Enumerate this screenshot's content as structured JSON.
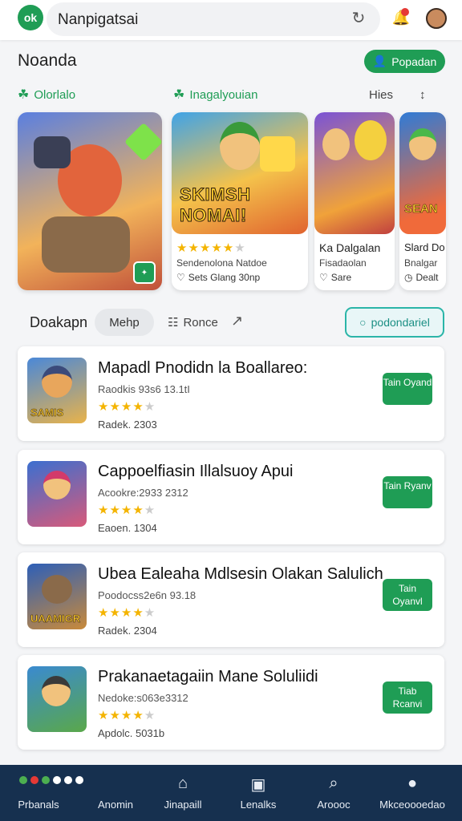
{
  "header": {
    "logo_text": "ok",
    "search_text": "Nanpigatsai",
    "refresh_icon": "refresh-icon",
    "bell_icon": "bell-icon"
  },
  "featured": {
    "title": "Noanda",
    "popular_button": "Popadan",
    "filters": [
      "Olorlalo",
      "Inagalyouian"
    ],
    "right_controls": [
      "Hies",
      "↕"
    ],
    "cards": [
      {
        "art_title": ""
      },
      {
        "art_title": "SKIMSH NOMAI!",
        "sub": "Sendenolona Natdoe",
        "meta": "Sets Glang 30np",
        "rating": 4
      },
      {
        "name": "Ka Dalgalan",
        "sub": "Fisadaolan",
        "meta": "Sare",
        "rating": 0
      },
      {
        "name": "Slard Do",
        "sub": "Bnalgar",
        "meta": "Dealt",
        "art_title": "SEAN",
        "rating": 0
      }
    ]
  },
  "tabs": {
    "main": "Doakapn",
    "pill": "Mehp",
    "icon_label": "Ronce",
    "download_button": "podondariel"
  },
  "list": [
    {
      "thumb_label": "SAMIS",
      "title": "Mapadl Pnodidn la Boallareo:",
      "sub": "Raodkis 93s6 13.1tI",
      "rating": 4,
      "meta": "Radek.  2303",
      "button": "Tain Oyand"
    },
    {
      "thumb_label": "",
      "title": "Cappoelfiasin Illalsuoy Apui",
      "sub": "Acookre:2933 2312",
      "rating": 4,
      "meta": "Eaoen.  1304",
      "button": "Tain Ryanv"
    },
    {
      "thumb_label": "UAAMIGR",
      "title": "Ubea Ealeaha Mdlsesin Olakan Salulich",
      "sub": "Poodocss2e6n 93.18",
      "rating": 4,
      "meta": "Radek.  2304",
      "button": "Tain Oyanvl"
    },
    {
      "thumb_label": "",
      "title": "Prakanaetagaiin Mane Soluliidi",
      "sub": "Nedoke:s063e3312",
      "rating": 4,
      "meta": "Apdolc.  5031b",
      "button": "Tiab Rcanvi"
    }
  ],
  "bottom_nav": [
    {
      "label": "Prbanals",
      "icon": "dots"
    },
    {
      "label": "Anomin",
      "icon": "recycle-icon"
    },
    {
      "label": "Jinapaill",
      "icon": "store-icon"
    },
    {
      "label": "Lenalks",
      "icon": "book-icon"
    },
    {
      "label": "Aroooc",
      "icon": "search-icon"
    },
    {
      "label": "Mkceoooedao",
      "icon": "profile-icon"
    }
  ]
}
